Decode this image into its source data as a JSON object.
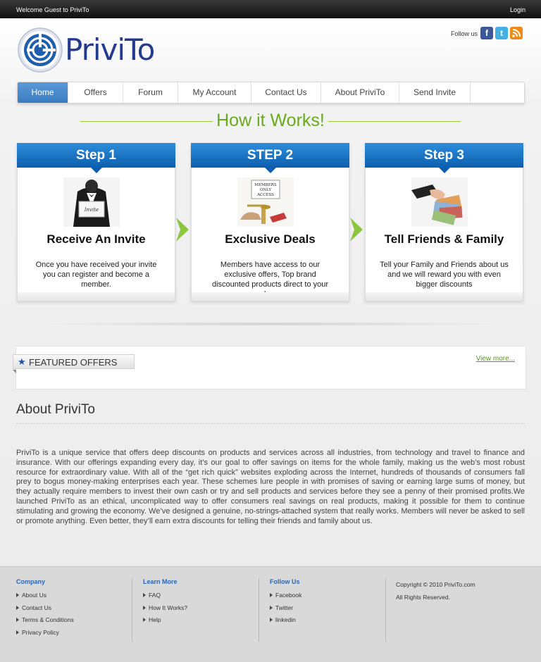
{
  "topbar": {
    "welcome": "Welcome Guest to PriviTo",
    "login": "Login"
  },
  "brand": {
    "name": "PriviTo"
  },
  "follow": {
    "label": "Follow us",
    "icons": [
      "facebook-icon",
      "twitter-icon",
      "rss-icon"
    ]
  },
  "nav": {
    "items": [
      "Home",
      "Offers",
      "Forum",
      "My Account",
      "Contact Us",
      "About PriviTo",
      "Send Invite"
    ],
    "active": "Home"
  },
  "how_it_works": {
    "title": "How it Works!"
  },
  "steps": [
    {
      "header": "Step 1",
      "title": "Receive An Invite",
      "text": "Once you have received your invite you can register and become a member."
    },
    {
      "header": "STEP 2",
      "title": "Exclusive Deals",
      "text": "Members have access to our exclusive offers, Top brand discounted products direct to your door."
    },
    {
      "header": "Step 3",
      "title": "Tell Friends & Family",
      "text": "Tell your Family and Friends about us and we will reward you with even bigger discounts"
    }
  ],
  "featured": {
    "label": "FEATURED OFFERS",
    "view_more": "View more..."
  },
  "about": {
    "title": "About PriviTo",
    "body": "PriviTo is a unique service that offers deep discounts on products and services across all industries, from technology and travel to finance and insurance. With our offerings expanding every day, it’s our goal to offer savings on items for the whole family, making us the web’s most robust resource for extraordinary value. With all of the “get rich quick” websites exploding across the Internet, hundreds of thousands of consumers fall prey to bogus money-making enterprises each year. These schemes lure people in with promises of saving or earning large sums of money, but they actually require members to invest their own cash or try and sell products and services before they see a penny of their promised profits.We launched PriviTo as an ethical, uncomplicated way to offer consumers real savings on real products, making it possible for them to continue stimulating and growing the economy. We’ve designed a genuine, no-strings-attached system that really works. Members will never be asked to sell or promote anything. Even better, they’ll earn extra discounts for telling their friends and family about us."
  },
  "footer": {
    "company": {
      "title": "Company",
      "items": [
        "About Us",
        "Contact Us",
        "Terms & Conditions",
        "Privacy Policy"
      ]
    },
    "learn": {
      "title": "Learn More",
      "items": [
        "FAQ",
        "How It Works?",
        "Help"
      ]
    },
    "follow": {
      "title": "Follow Us",
      "items": [
        "Facebook",
        "Twitter",
        "linkedin"
      ]
    },
    "copyright": "Copyright © 2010 PriviTo.com",
    "rights": "All Rights Reserved."
  },
  "colors": {
    "accent_blue": "#1a72c6",
    "green": "#6aab1e",
    "brand_navy": "#253a8c"
  }
}
